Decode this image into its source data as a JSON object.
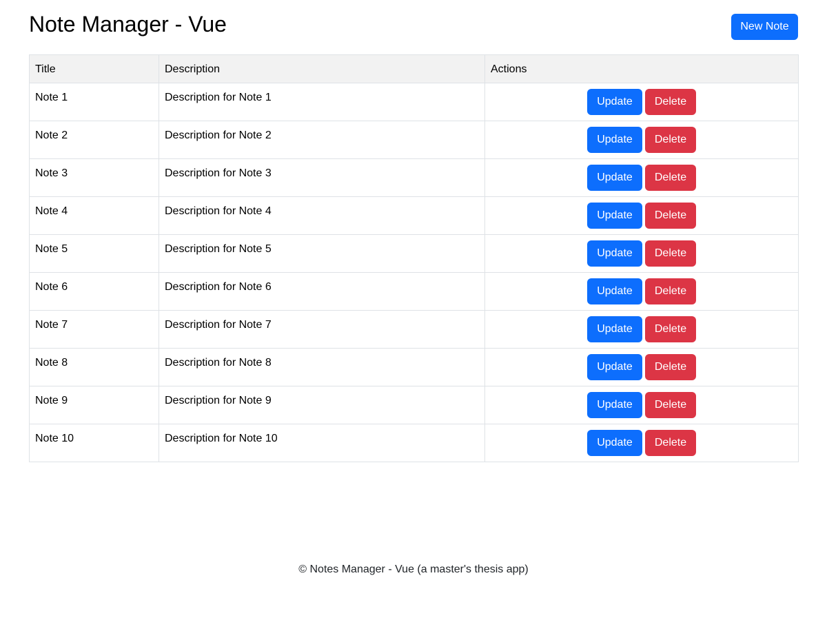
{
  "header": {
    "title": "Note Manager - Vue",
    "new_note_label": "New Note"
  },
  "table": {
    "columns": [
      "Title",
      "Description",
      "Actions"
    ],
    "update_label": "Update",
    "delete_label": "Delete",
    "rows": [
      {
        "title": "Note 1",
        "description": "Description for Note 1"
      },
      {
        "title": "Note 2",
        "description": "Description for Note 2"
      },
      {
        "title": "Note 3",
        "description": "Description for Note 3"
      },
      {
        "title": "Note 4",
        "description": "Description for Note 4"
      },
      {
        "title": "Note 5",
        "description": "Description for Note 5"
      },
      {
        "title": "Note 6",
        "description": "Description for Note 6"
      },
      {
        "title": "Note 7",
        "description": "Description for Note 7"
      },
      {
        "title": "Note 8",
        "description": "Description for Note 8"
      },
      {
        "title": "Note 9",
        "description": "Description for Note 9"
      },
      {
        "title": "Note 10",
        "description": "Description for Note 10"
      }
    ]
  },
  "footer": {
    "text": "© Notes Manager - Vue (a master's thesis app)"
  },
  "colors": {
    "primary": "#0d6efd",
    "danger": "#dc3545",
    "header_bg": "#f2f2f2",
    "border": "#dee2e6"
  }
}
